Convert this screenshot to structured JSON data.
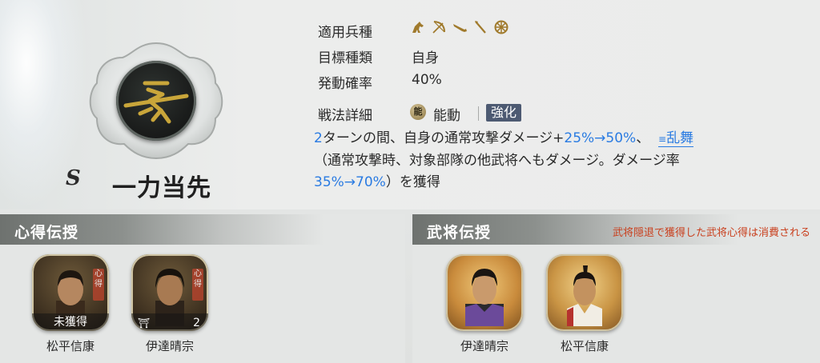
{
  "skill": {
    "rank": "S",
    "name": "一力当先"
  },
  "properties": {
    "unit_type_label": "適用兵種",
    "unit_icons": [
      "cavalry-icon",
      "bow-icon",
      "gun-icon",
      "spear-icon",
      "wheel-icon"
    ],
    "target_label": "目標種類",
    "target_value": "自身",
    "chance_label": "発動確率",
    "chance_value": "40%"
  },
  "detail": {
    "label": "戦法詳細",
    "type_badge": "能",
    "type_text": "能動",
    "enhance_label": "強化",
    "desc": {
      "p1": "2",
      "p2": "ターンの間、自身の通常攻撃ダメージ+",
      "p3": "25%→50%",
      "p4": "、",
      "p5": "乱舞",
      "p6": "（通常攻撃時、対象部隊の他武将へもダメージ。ダメージ率",
      "p7": "35%→70%",
      "p8": "）を獲得"
    }
  },
  "left_panel": {
    "title": "心得伝授",
    "cards": [
      {
        "name": "松平信康",
        "status": "未獲得",
        "tag": "心得"
      },
      {
        "name": "伊達晴宗",
        "count": "2",
        "tag": "心得"
      }
    ]
  },
  "right_panel": {
    "title": "武将伝授",
    "note": "武将隠退で獲得した武将心得は消費される",
    "cards": [
      {
        "name": "伊達晴宗"
      },
      {
        "name": "松平信康"
      }
    ]
  },
  "colors": {
    "accent_blue": "#2a7be2",
    "note_red": "#c9401e",
    "enhance_badge": "#4d5a72",
    "gold": "#a07a2c"
  }
}
